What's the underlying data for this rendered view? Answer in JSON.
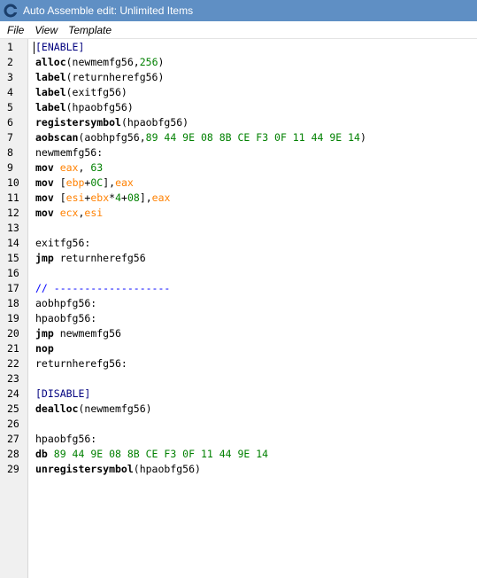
{
  "window": {
    "title": "Auto Assemble edit: Unlimited Items"
  },
  "menu": {
    "items": [
      "File",
      "View",
      "Template"
    ]
  },
  "colors": {
    "default": "#000000",
    "number": "#008000",
    "register": "#ff8000",
    "section": "#00007f",
    "comment": "#0000ff"
  },
  "lines": [
    [
      {
        "t": "[ENABLE]",
        "c": "section"
      }
    ],
    [
      {
        "t": "alloc",
        "c": "default",
        "b": true
      },
      {
        "t": "(newmemfg56,",
        "c": "default"
      },
      {
        "t": "256",
        "c": "number"
      },
      {
        "t": ")",
        "c": "default"
      }
    ],
    [
      {
        "t": "label",
        "c": "default",
        "b": true
      },
      {
        "t": "(returnherefg56)",
        "c": "default"
      }
    ],
    [
      {
        "t": "label",
        "c": "default",
        "b": true
      },
      {
        "t": "(exitfg56)",
        "c": "default"
      }
    ],
    [
      {
        "t": "label",
        "c": "default",
        "b": true
      },
      {
        "t": "(hpaobfg56)",
        "c": "default"
      }
    ],
    [
      {
        "t": "registersymbol",
        "c": "default",
        "b": true
      },
      {
        "t": "(hpaobfg56)",
        "c": "default"
      }
    ],
    [
      {
        "t": "aobscan",
        "c": "default",
        "b": true
      },
      {
        "t": "(aobhpfg56,",
        "c": "default"
      },
      {
        "t": "89 44 9E 08 8B CE F3 0F 11 44 9E 14",
        "c": "number"
      },
      {
        "t": ")",
        "c": "default"
      }
    ],
    [
      {
        "t": "newmemfg56:",
        "c": "default"
      }
    ],
    [
      {
        "t": "mov ",
        "c": "default",
        "b": true
      },
      {
        "t": "eax",
        "c": "register"
      },
      {
        "t": ", ",
        "c": "default"
      },
      {
        "t": "63",
        "c": "number"
      }
    ],
    [
      {
        "t": "mov ",
        "c": "default",
        "b": true
      },
      {
        "t": "[",
        "c": "default"
      },
      {
        "t": "ebp",
        "c": "register"
      },
      {
        "t": "+",
        "c": "default"
      },
      {
        "t": "0C",
        "c": "number"
      },
      {
        "t": "],",
        "c": "default"
      },
      {
        "t": "eax",
        "c": "register"
      }
    ],
    [
      {
        "t": "mov ",
        "c": "default",
        "b": true
      },
      {
        "t": "[",
        "c": "default"
      },
      {
        "t": "esi",
        "c": "register"
      },
      {
        "t": "+",
        "c": "default"
      },
      {
        "t": "ebx",
        "c": "register"
      },
      {
        "t": "*",
        "c": "default"
      },
      {
        "t": "4",
        "c": "number"
      },
      {
        "t": "+",
        "c": "default"
      },
      {
        "t": "08",
        "c": "number"
      },
      {
        "t": "],",
        "c": "default"
      },
      {
        "t": "eax",
        "c": "register"
      }
    ],
    [
      {
        "t": "mov ",
        "c": "default",
        "b": true
      },
      {
        "t": "ecx",
        "c": "register"
      },
      {
        "t": ",",
        "c": "default"
      },
      {
        "t": "esi",
        "c": "register"
      }
    ],
    [],
    [
      {
        "t": "exitfg56:",
        "c": "default"
      }
    ],
    [
      {
        "t": "jmp ",
        "c": "default",
        "b": true
      },
      {
        "t": "returnherefg56",
        "c": "default"
      }
    ],
    [],
    [
      {
        "t": "// -------------------",
        "c": "comment"
      }
    ],
    [
      {
        "t": "aobhpfg56:",
        "c": "default"
      }
    ],
    [
      {
        "t": "hpaobfg56:",
        "c": "default"
      }
    ],
    [
      {
        "t": "jmp ",
        "c": "default",
        "b": true
      },
      {
        "t": "newmemfg56",
        "c": "default"
      }
    ],
    [
      {
        "t": "nop",
        "c": "default",
        "b": true
      }
    ],
    [
      {
        "t": "returnherefg56:",
        "c": "default"
      }
    ],
    [],
    [
      {
        "t": "[DISABLE]",
        "c": "section"
      }
    ],
    [
      {
        "t": "dealloc",
        "c": "default",
        "b": true
      },
      {
        "t": "(newmemfg56)",
        "c": "default"
      }
    ],
    [],
    [
      {
        "t": "hpaobfg56:",
        "c": "default"
      }
    ],
    [
      {
        "t": "db ",
        "c": "default",
        "b": true
      },
      {
        "t": "89 44 9E 08 8B CE F3 0F 11 44 9E 14",
        "c": "number"
      }
    ],
    [
      {
        "t": "unregistersymbol",
        "c": "default",
        "b": true
      },
      {
        "t": "(hpaobfg56)",
        "c": "default"
      }
    ]
  ]
}
